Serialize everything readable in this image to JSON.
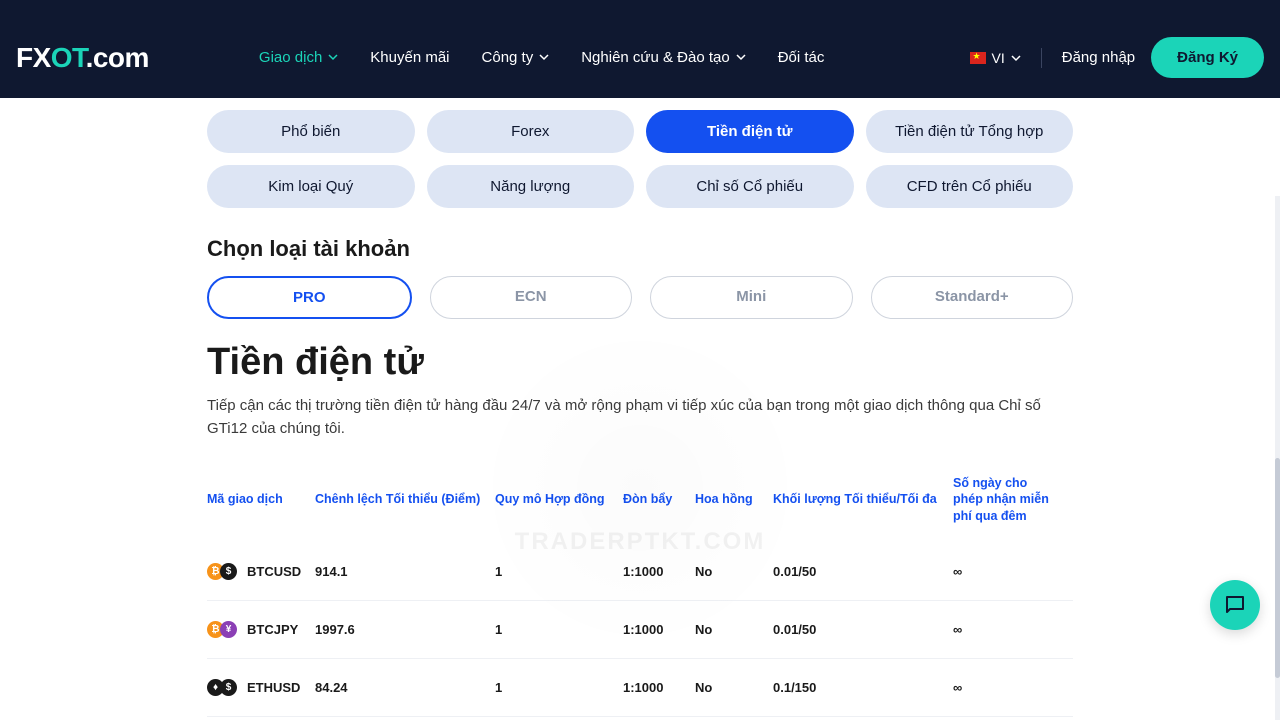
{
  "brand": {
    "fx": "FX",
    "ot": "OT",
    "tail": ".com"
  },
  "nav": {
    "items": [
      {
        "label": "Giao dịch",
        "hasChevron": true,
        "active": true
      },
      {
        "label": "Khuyến mãi",
        "hasChevron": false
      },
      {
        "label": "Công ty",
        "hasChevron": true
      },
      {
        "label": "Nghiên cứu & Đào tạo",
        "hasChevron": true
      },
      {
        "label": "Đối tác",
        "hasChevron": false
      }
    ],
    "lang": "VI",
    "login": "Đăng nhập",
    "signup": "Đăng Ký"
  },
  "categories": [
    {
      "label": "Phổ biến"
    },
    {
      "label": "Forex"
    },
    {
      "label": "Tiền điện tử",
      "active": true
    },
    {
      "label": "Tiền điện tử Tổng hợp"
    },
    {
      "label": "Kim loại Quý"
    },
    {
      "label": "Năng lượng"
    },
    {
      "label": "Chỉ số Cổ phiếu"
    },
    {
      "label": "CFD trên Cổ phiếu"
    }
  ],
  "account_section_title": "Chọn loại tài khoản",
  "accounts": [
    {
      "label": "PRO",
      "active": true
    },
    {
      "label": "ECN"
    },
    {
      "label": "Mini"
    },
    {
      "label": "Standard+"
    }
  ],
  "page_title": "Tiền điện tử",
  "page_desc": "Tiếp cận các thị trường tiền điện tử hàng đầu 24/7 và mở rộng phạm vi tiếp xúc của bạn trong một giao dịch thông qua Chỉ số GTi12 của chúng tôi.",
  "table": {
    "headers": {
      "symbol": "Mã giao dịch",
      "spread": "Chênh lệch Tối thiểu (Điểm)",
      "contract": "Quy mô Hợp đồng",
      "leverage": "Đòn bẩy",
      "commission": "Hoa hồng",
      "volume": "Khối lượng Tối thiểu/Tối đa",
      "swapfree": "Số ngày cho phép nhận miễn phí qua đêm"
    },
    "rows": [
      {
        "icon1": "btc",
        "icon2": "usd",
        "sym": "BTCUSD",
        "spread": "914.1",
        "contract": "1",
        "lev": "1:1000",
        "comm": "No",
        "vol": "0.01/50",
        "swap": "∞"
      },
      {
        "icon1": "btc",
        "icon2": "jpy",
        "sym": "BTCJPY",
        "spread": "1997.6",
        "contract": "1",
        "lev": "1:1000",
        "comm": "No",
        "vol": "0.01/50",
        "swap": "∞"
      },
      {
        "icon1": "eth",
        "icon2": "usd",
        "sym": "ETHUSD",
        "spread": "84.24",
        "contract": "1",
        "lev": "1:1000",
        "comm": "No",
        "vol": "0.1/150",
        "swap": "∞"
      }
    ]
  },
  "watermark": "TRADERPTKT.COM"
}
